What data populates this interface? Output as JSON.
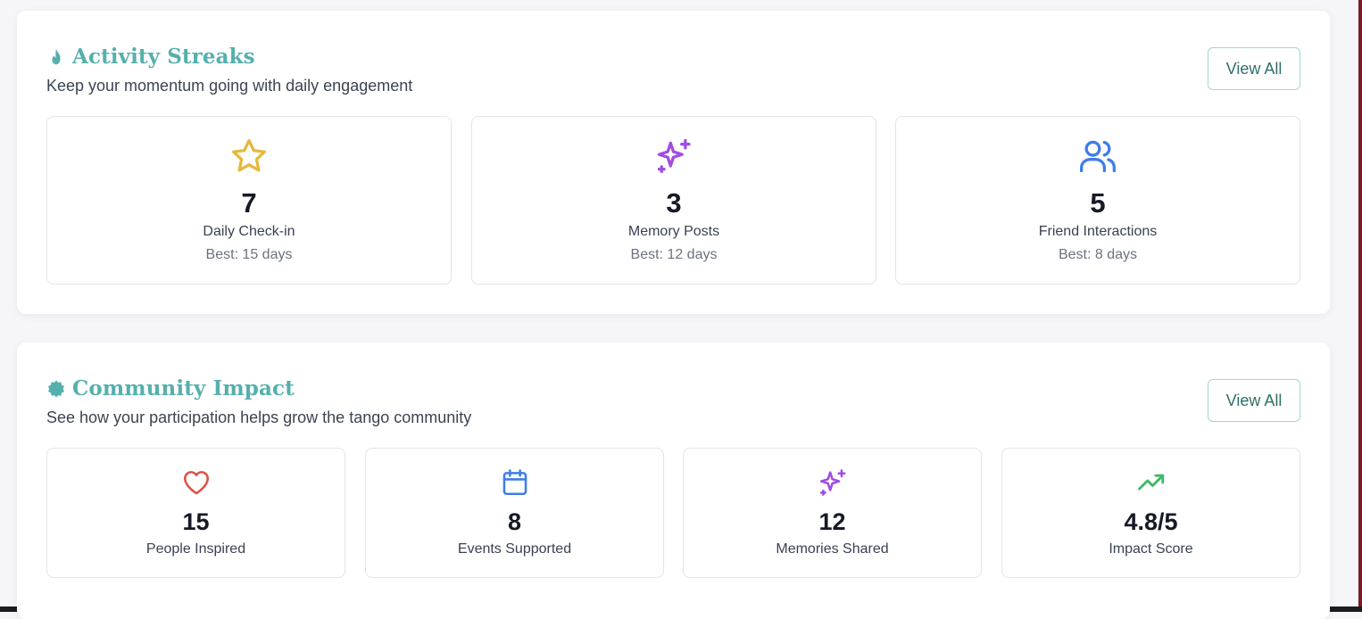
{
  "streaks": {
    "title": "Activity Streaks",
    "subtitle": "Keep your momentum going with daily engagement",
    "view_all_label": "View All",
    "cards": [
      {
        "icon": "star-icon",
        "value": "7",
        "label": "Daily Check-in",
        "best": "Best: 15 days",
        "color": "#e5b93a"
      },
      {
        "icon": "sparkles-icon",
        "value": "3",
        "label": "Memory Posts",
        "best": "Best: 12 days",
        "color": "#a04de0"
      },
      {
        "icon": "users-icon",
        "value": "5",
        "label": "Friend Interactions",
        "best": "Best: 8 days",
        "color": "#3f7de8"
      }
    ]
  },
  "impact": {
    "title": "Community Impact",
    "subtitle": "See how your participation helps grow the tango community",
    "view_all_label": "View All",
    "cards": [
      {
        "icon": "heart-icon",
        "value": "15",
        "label": "People Inspired",
        "color": "#e0504a"
      },
      {
        "icon": "calendar-icon",
        "value": "8",
        "label": "Events Supported",
        "color": "#3f7de8"
      },
      {
        "icon": "sparkles-icon",
        "value": "12",
        "label": "Memories Shared",
        "color": "#a04de0"
      },
      {
        "icon": "trending-up-icon",
        "value": "4.8/5",
        "label": "Impact Score",
        "color": "#3fb866"
      }
    ]
  },
  "colors": {
    "accent_teal": "#55b0ad",
    "button_border": "#9fd7d3",
    "button_text": "#2d6f6b"
  }
}
